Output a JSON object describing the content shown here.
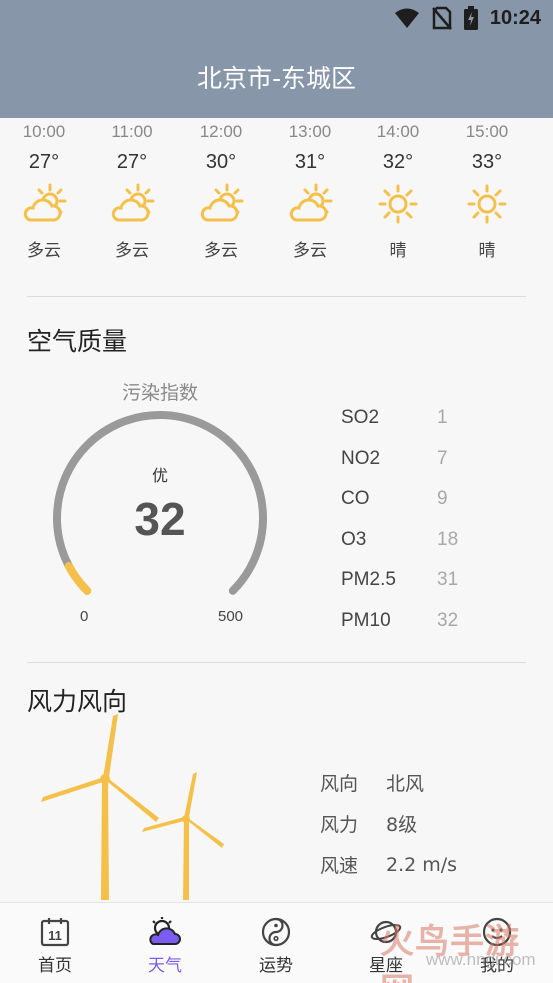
{
  "status_bar": {
    "time": "10:24"
  },
  "header": {
    "title": "北京市-东城区"
  },
  "hourly": [
    {
      "time": "10:00",
      "temp": "27°",
      "icon": "partly-cloudy-icon",
      "desc": "多云"
    },
    {
      "time": "11:00",
      "temp": "27°",
      "icon": "partly-cloudy-icon",
      "desc": "多云"
    },
    {
      "time": "12:00",
      "temp": "30°",
      "icon": "partly-cloudy-icon",
      "desc": "多云"
    },
    {
      "time": "13:00",
      "temp": "31°",
      "icon": "partly-cloudy-icon",
      "desc": "多云"
    },
    {
      "time": "14:00",
      "temp": "32°",
      "icon": "sunny-icon",
      "desc": "晴"
    },
    {
      "time": "15:00",
      "temp": "33°",
      "icon": "sunny-icon",
      "desc": "晴"
    }
  ],
  "air_quality": {
    "title": "空气质量",
    "gauge_label": "污染指数",
    "level": "优",
    "value": "32",
    "min": "0",
    "max": "500",
    "fill_fraction": 0.064,
    "pollutants": [
      {
        "name": "SO2",
        "value": "1"
      },
      {
        "name": "NO2",
        "value": "7"
      },
      {
        "name": "CO",
        "value": "9"
      },
      {
        "name": "O3",
        "value": "18"
      },
      {
        "name": "PM2.5",
        "value": "31"
      },
      {
        "name": "PM10",
        "value": "32"
      }
    ]
  },
  "wind": {
    "title": "风力风向",
    "rows": [
      {
        "key": "风向",
        "value": "北风"
      },
      {
        "key": "风力",
        "value": "8级"
      },
      {
        "key": "风速",
        "value": "2.2 m/s"
      }
    ]
  },
  "nav": [
    {
      "label": "首页",
      "icon": "calendar-icon",
      "active": false
    },
    {
      "label": "天气",
      "icon": "weather-icon",
      "active": true
    },
    {
      "label": "运势",
      "icon": "yin-yang-icon",
      "active": false
    },
    {
      "label": "星座",
      "icon": "constellation-icon",
      "active": false
    },
    {
      "label": "我的",
      "icon": "profile-icon",
      "active": false
    }
  ],
  "calendar_icon_text": "11",
  "watermark": {
    "text": "火鸟手游网",
    "url": "www.hngi.com"
  },
  "colors": {
    "header_bg": "#8896aa",
    "accent_yellow": "#f5c04a",
    "gauge_track": "#9a9a9a",
    "nav_active": "#7b5cf0"
  }
}
